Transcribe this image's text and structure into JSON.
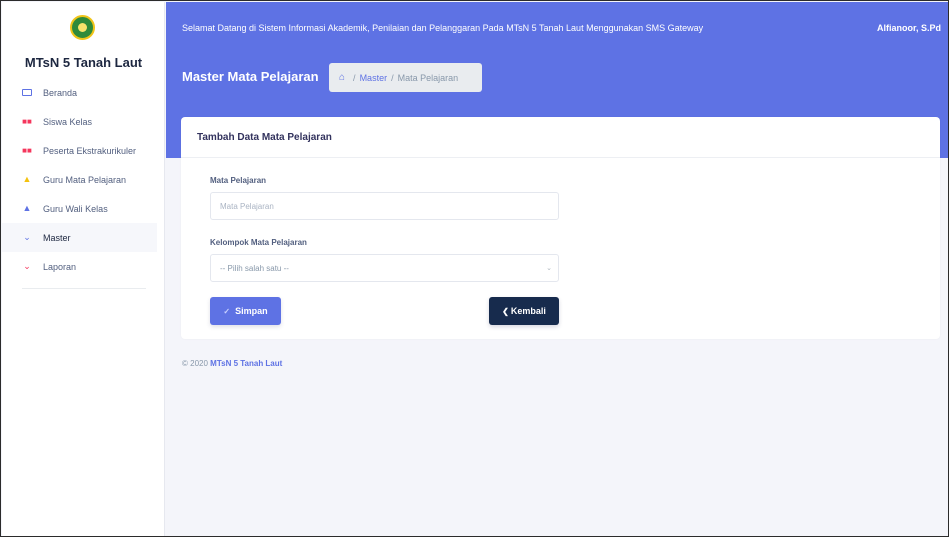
{
  "brand": {
    "name": "MTsN 5 Tanah Laut"
  },
  "sidebar": {
    "items": [
      {
        "label": "Beranda",
        "icon": "monitor-icon"
      },
      {
        "label": "Siswa Kelas",
        "icon": "users-icon"
      },
      {
        "label": "Peserta Ekstrakurikuler",
        "icon": "users-icon"
      },
      {
        "label": "Guru Mata Pelajaran",
        "icon": "graduation-cap-icon"
      },
      {
        "label": "Guru Wali Kelas",
        "icon": "graduation-cap-icon"
      },
      {
        "label": "Master",
        "icon": "chevron-down-icon",
        "active": true
      },
      {
        "label": "Laporan",
        "icon": "chevron-down-icon"
      }
    ]
  },
  "topbar": {
    "welcome": "Selamat Datang di Sistem Informasi Akademik, Penilaian dan Pelanggaran Pada MTsN 5 Tanah Laut Menggunakan SMS Gateway",
    "user": "Alfianoor, S.Pd"
  },
  "header": {
    "title": "Master Mata Pelajaran",
    "breadcrumb": {
      "home_icon": "home-icon",
      "sep": "/",
      "master": "Master",
      "current": "Mata Pelajaran"
    }
  },
  "card": {
    "title": "Tambah Data Mata Pelajaran",
    "field_mapel": {
      "label": "Mata Pelajaran",
      "placeholder": "Mata Pelajaran",
      "value": ""
    },
    "field_kelompok": {
      "label": "Kelompok Mata Pelajaran",
      "selected": "-- Pilih salah satu --"
    },
    "save_label": "Simpan",
    "back_label": "Kembali"
  },
  "footer": {
    "copyright": "© 2020",
    "org": "MTsN 5 Tanah Laut"
  },
  "colors": {
    "primary": "#5e72e4",
    "dark": "#172b4d",
    "danger": "#f5365c",
    "warning": "#f4c20d"
  }
}
